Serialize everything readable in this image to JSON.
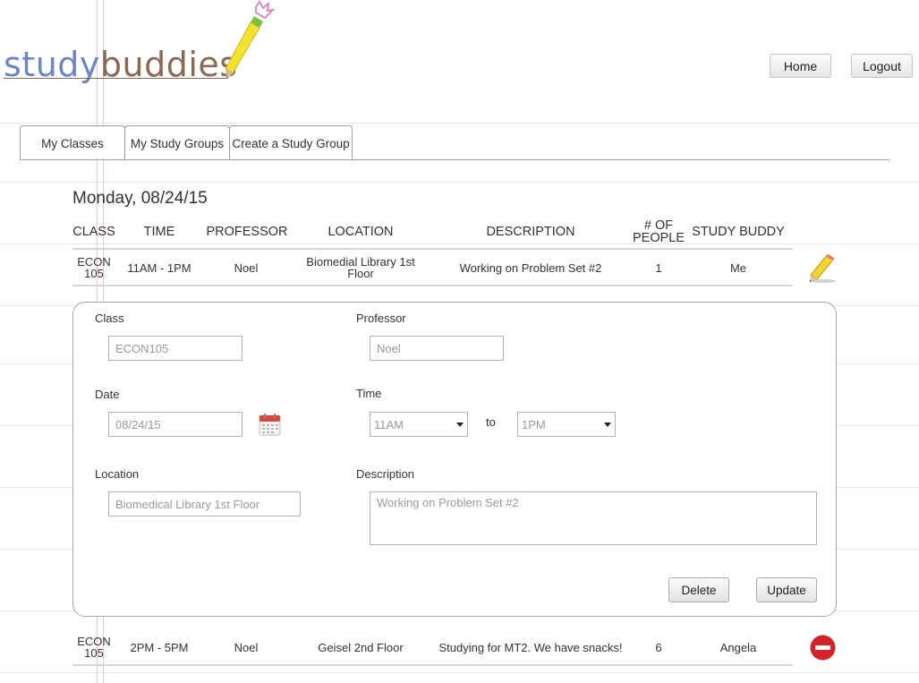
{
  "logo": {
    "part1": "study",
    "part2": "buddies"
  },
  "nav": {
    "home": "Home",
    "logout": "Logout"
  },
  "tabs": [
    "My Classes",
    "My Study Groups",
    "Create a Study Group"
  ],
  "date_heading": "Monday, 08/24/15",
  "table": {
    "headers": [
      "CLASS",
      "TIME",
      "PROFESSOR",
      "LOCATION",
      "DESCRIPTION",
      "# OF PEOPLE",
      "STUDY BUDDY"
    ],
    "rows": [
      {
        "class": "ECON 105",
        "time": "11AM - 1PM",
        "professor": "Noel",
        "location": "Biomedial Library 1st Floor",
        "description": "Working on Problem Set #2",
        "people": "1",
        "buddy": "Me",
        "action_icon": "pencil-edit-icon"
      },
      {
        "class": "ECON 105",
        "time": "2PM - 5PM",
        "professor": "Noel",
        "location": "Geisel 2nd Floor",
        "description": "Studying for MT2. We have snacks!",
        "people": "6",
        "buddy": "Angela",
        "action_icon": "remove-icon"
      }
    ]
  },
  "form": {
    "labels": {
      "class": "Class",
      "professor": "Professor",
      "date": "Date",
      "time": "Time",
      "to": "to",
      "location": "Location",
      "description": "Description"
    },
    "values": {
      "class": "ECON105",
      "professor": "Noel",
      "date": "08/24/15",
      "time_start": "11AM",
      "time_end": "1PM",
      "location": "Biomedical Library 1st Floor",
      "description": "Working on Problem Set #2"
    },
    "buttons": {
      "delete": "Delete",
      "update": "Update"
    }
  },
  "colors": {
    "logo_study": "#6f86c4",
    "logo_buddies": "#8a6a55",
    "remove": "#d2232a",
    "pencil": "#f2d530",
    "calendar": "#d9463c"
  }
}
